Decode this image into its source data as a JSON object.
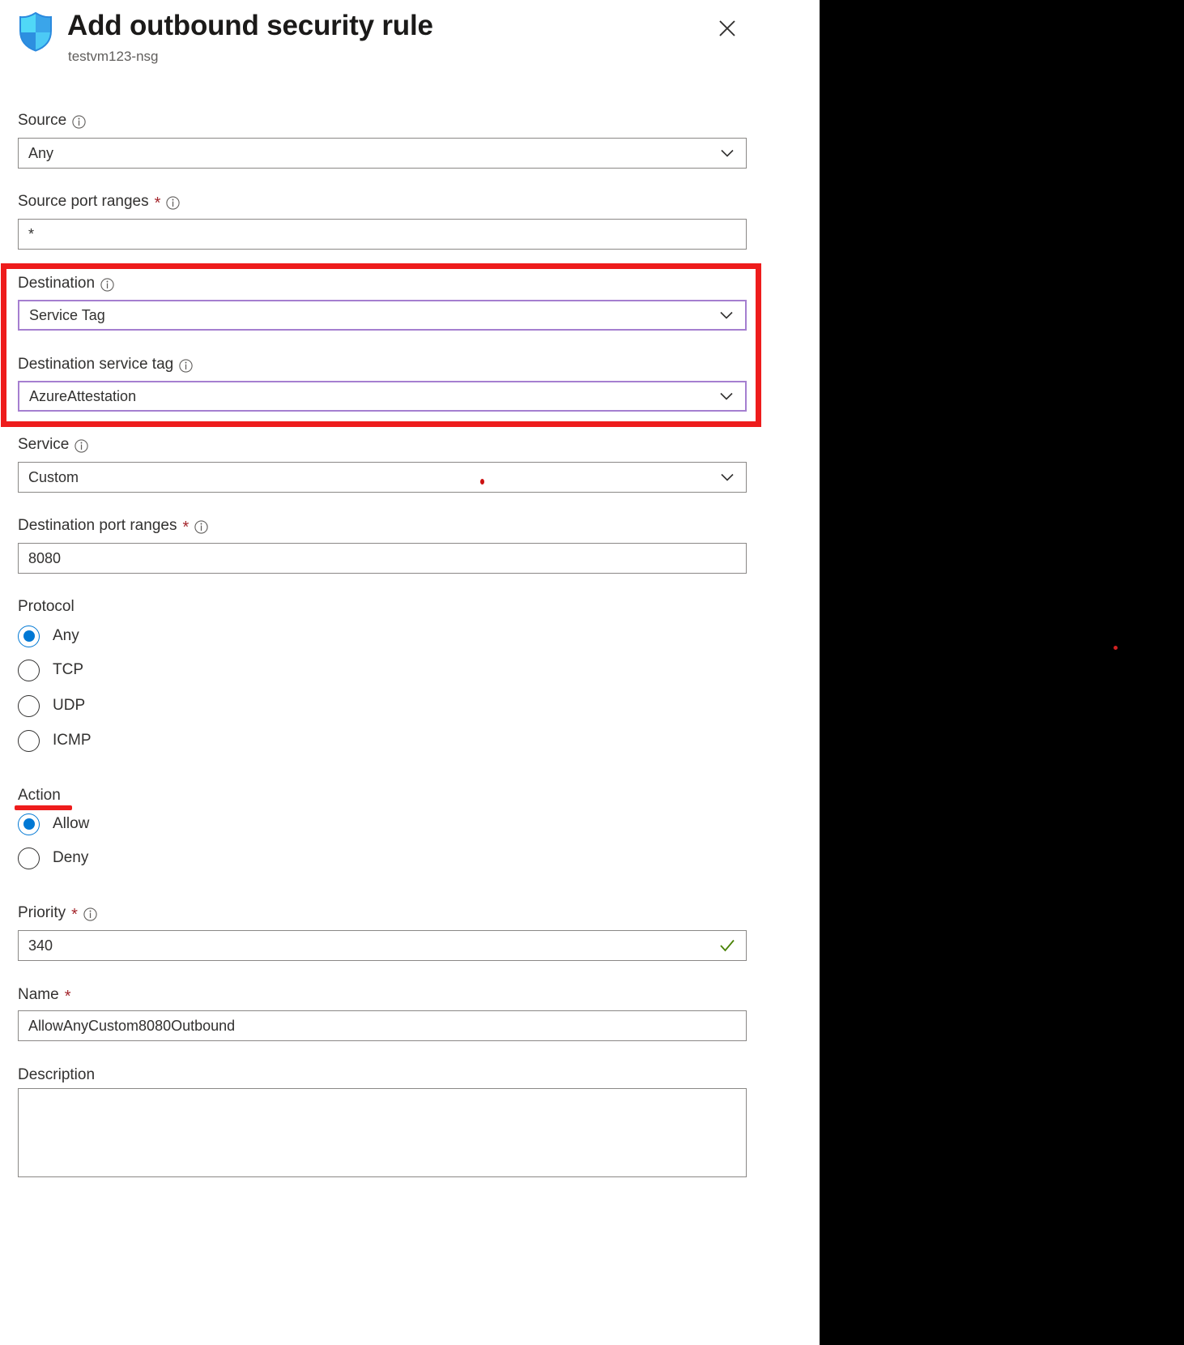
{
  "header": {
    "title": "Add outbound security rule",
    "subtitle": "testvm123-nsg",
    "shield_icon": "shield-icon",
    "close_icon": "close-icon",
    "close_label": "Close"
  },
  "form": {
    "source": {
      "label": "Source",
      "info_icon": "info-icon",
      "value": "Any",
      "chevron_icon": "chevron-down-icon",
      "required": false
    },
    "source_port_ranges": {
      "label": "Source port ranges",
      "info_icon": "info-icon",
      "value": "*",
      "required": true,
      "required_mark": "*"
    },
    "destination": {
      "label": "Destination",
      "info_icon": "info-icon",
      "value": "Service Tag",
      "chevron_icon": "chevron-down-icon",
      "required": false,
      "focused": true
    },
    "destination_service_tag": {
      "label": "Destination service tag",
      "info_icon": "info-icon",
      "value": "AzureAttestation",
      "chevron_icon": "chevron-down-icon",
      "required": false,
      "focused": true
    },
    "service": {
      "label": "Service",
      "info_icon": "info-icon",
      "value": "Custom",
      "chevron_icon": "chevron-down-icon",
      "required": false
    },
    "destination_port_ranges": {
      "label": "Destination port ranges",
      "info_icon": "info-icon",
      "value": "8080",
      "required": true,
      "required_mark": "*"
    },
    "protocol": {
      "label": "Protocol",
      "selected": "Any",
      "options": [
        "Any",
        "TCP",
        "UDP",
        "ICMP"
      ]
    },
    "action": {
      "label": "Action",
      "selected": "Allow",
      "options": [
        "Allow",
        "Deny"
      ]
    },
    "priority": {
      "label": "Priority",
      "info_icon": "info-icon",
      "value": "340",
      "required": true,
      "required_mark": "*",
      "valid_icon": "checkmark-icon"
    },
    "name": {
      "label": "Name",
      "value": "AllowAnyCustom8080Outbound",
      "required": true,
      "required_mark": "*"
    },
    "description": {
      "label": "Description",
      "value": "",
      "placeholder": ""
    }
  },
  "annotations": {
    "destination_highlight_color": "#ee1c1c",
    "action_underline_color": "#ee1c1c",
    "focus_border_color": "#a57fd0",
    "accent_color": "#0078d4",
    "valid_color": "#498205",
    "required_color": "#a4262c"
  }
}
